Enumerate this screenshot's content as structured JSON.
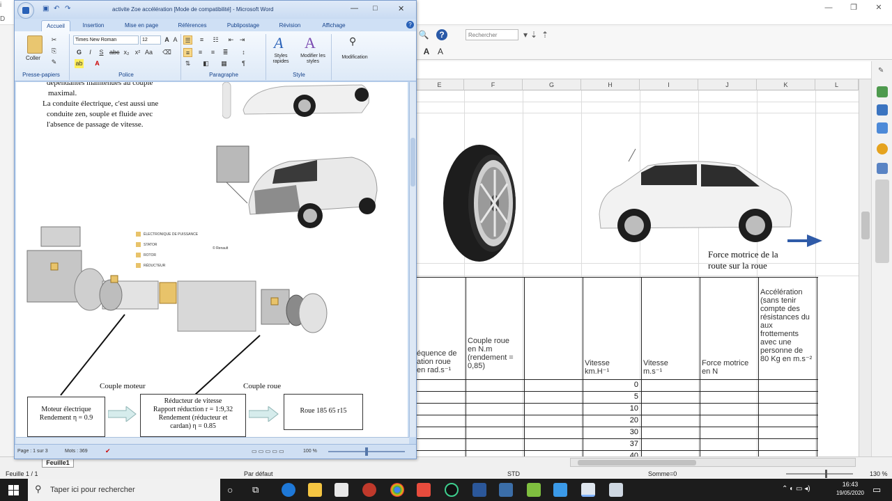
{
  "calc": {
    "search_placeholder": "Rechercher",
    "columns": [
      "E",
      "F",
      "G",
      "H",
      "I",
      "J",
      "K",
      "L"
    ],
    "force_label_line1": "Force motrice de la",
    "force_label_line2": "route sur la roue",
    "table_headers": {
      "frequence": [
        "équence de",
        "ation roue",
        "en rad.s⁻¹"
      ],
      "couple": [
        "Couple roue",
        "en N.m",
        "(rendement =",
        "0,85)"
      ],
      "vitesse_kmh": [
        "Vitesse",
        "km.H⁻¹"
      ],
      "vitesse_ms": [
        "Vitesse",
        "m.s⁻¹"
      ],
      "force": [
        "Force motrice",
        "en N"
      ],
      "acceleration": [
        "Accélération",
        "(sans tenir",
        "compte des",
        "résistances du",
        "aux",
        "frottements",
        "avec une",
        "personne de",
        "80 Kg en m.s⁻²"
      ]
    },
    "speeds": [
      "0",
      "5",
      "10",
      "20",
      "30",
      "37",
      "40"
    ],
    "sheet_tab": "Feuille1",
    "status_sheet": "Feuille 1 / 1",
    "status_style": "Par défaut",
    "status_sum": "Somme=0",
    "status_lang": "STD",
    "zoom": "130 %"
  },
  "word": {
    "title": "activite Zoe accélération [Mode de compatibilité] - Microsoft Word",
    "tabs": [
      "Accueil",
      "Insertion",
      "Mise en page",
      "Références",
      "Publipostage",
      "Révision",
      "Affichage"
    ],
    "font_name": "Times New Roman",
    "font_size": "12",
    "group_labels": [
      "Presse-papiers",
      "Police",
      "Paragraphe",
      "Style",
      "Modification"
    ],
    "paste_label": "Coller",
    "styles_rapides": "Styles rapides",
    "modifier_styles": "Modifier les styles",
    "modification_label": "Modification",
    "doc_lines": [
      "dépendantes maintenues au couple",
      "maximal.",
      "La conduite électrique, c'est aussi une",
      "conduite zen, souple et fluide avec",
      "l'absence de passage de vitesse."
    ],
    "legend": [
      "ÉLECTRONIQUE DE PUISSANCE",
      "STATOR",
      "ROTOR",
      "RÉDUCTEUR"
    ],
    "copyright": "© Renault",
    "couple_moteur": "Couple moteur",
    "couple_roue": "Couple roue",
    "box_moteur": [
      "Moteur électrique",
      "Rendement η = 0.9"
    ],
    "box_reducteur": [
      "Réducteur de vitesse",
      "Rapport réduction r = 1:9,32",
      "Rendement (réducteur et",
      "cardan) η = 0.85"
    ],
    "box_roue": "Roue 185 65 r15",
    "status_page": "Page : 1 sur 3",
    "status_words": "Mots : 369",
    "status_zoom": "100 %"
  },
  "taskbar": {
    "search_placeholder": "Taper ici pour rechercher",
    "time": "16:43",
    "date": "19/05/2020"
  },
  "colors": {
    "taskbar": "#1c1c1c",
    "word_frame": "#c5d9f1",
    "arrow_blue": "#2f5ba8"
  }
}
